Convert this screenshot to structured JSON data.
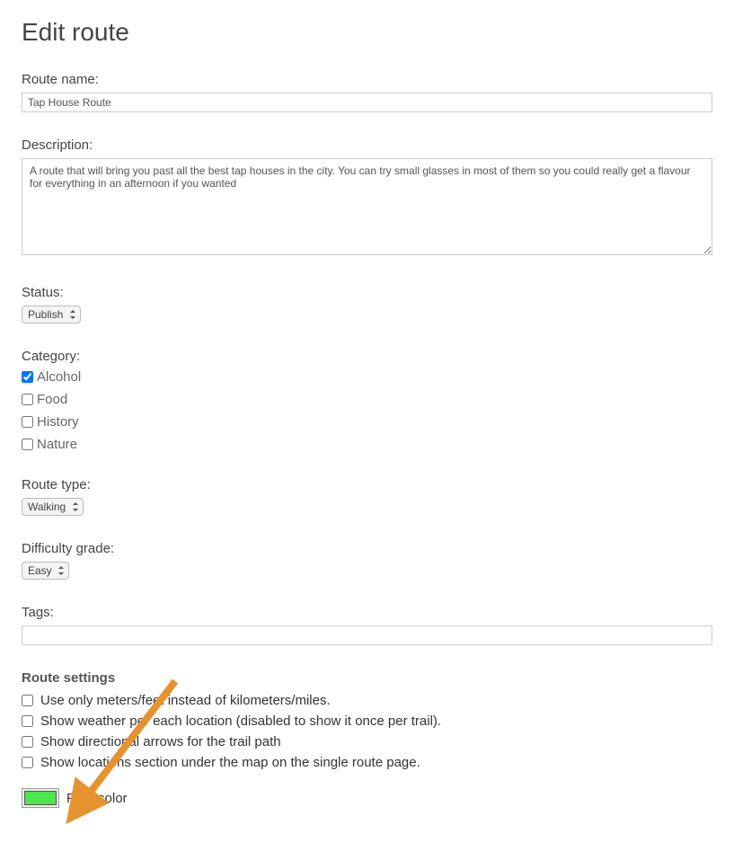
{
  "page": {
    "title": "Edit route"
  },
  "route_name": {
    "label": "Route name:",
    "value": "Tap House Route"
  },
  "description": {
    "label": "Description:",
    "value": "A route that will bring you past all the best tap houses in the city. You can try small glasses in most of them so you could really get a flavour for everything in an afternoon if you wanted"
  },
  "status": {
    "label": "Status:",
    "selected": "Publish"
  },
  "category": {
    "label": "Category:",
    "items": [
      {
        "label": "Alcohol",
        "checked": true
      },
      {
        "label": "Food",
        "checked": false
      },
      {
        "label": "History",
        "checked": false
      },
      {
        "label": "Nature",
        "checked": false
      }
    ]
  },
  "route_type": {
    "label": "Route type:",
    "selected": "Walking"
  },
  "difficulty": {
    "label": "Difficulty grade:",
    "selected": "Easy"
  },
  "tags": {
    "label": "Tags:",
    "value": ""
  },
  "route_settings": {
    "heading": "Route settings",
    "items": [
      {
        "label": "Use only meters/feet instead of kilometers/miles.",
        "checked": false
      },
      {
        "label": "Show weather per each location (disabled to show it once per trail).",
        "checked": false
      },
      {
        "label": "Show directional arrows for the trail path",
        "checked": false
      },
      {
        "label": "Show locations section under the map on the single route page.",
        "checked": false
      }
    ]
  },
  "path_color": {
    "label": "Path color",
    "value": "#4de64d"
  },
  "annotation_arrow": {
    "color": "#e6932f"
  }
}
